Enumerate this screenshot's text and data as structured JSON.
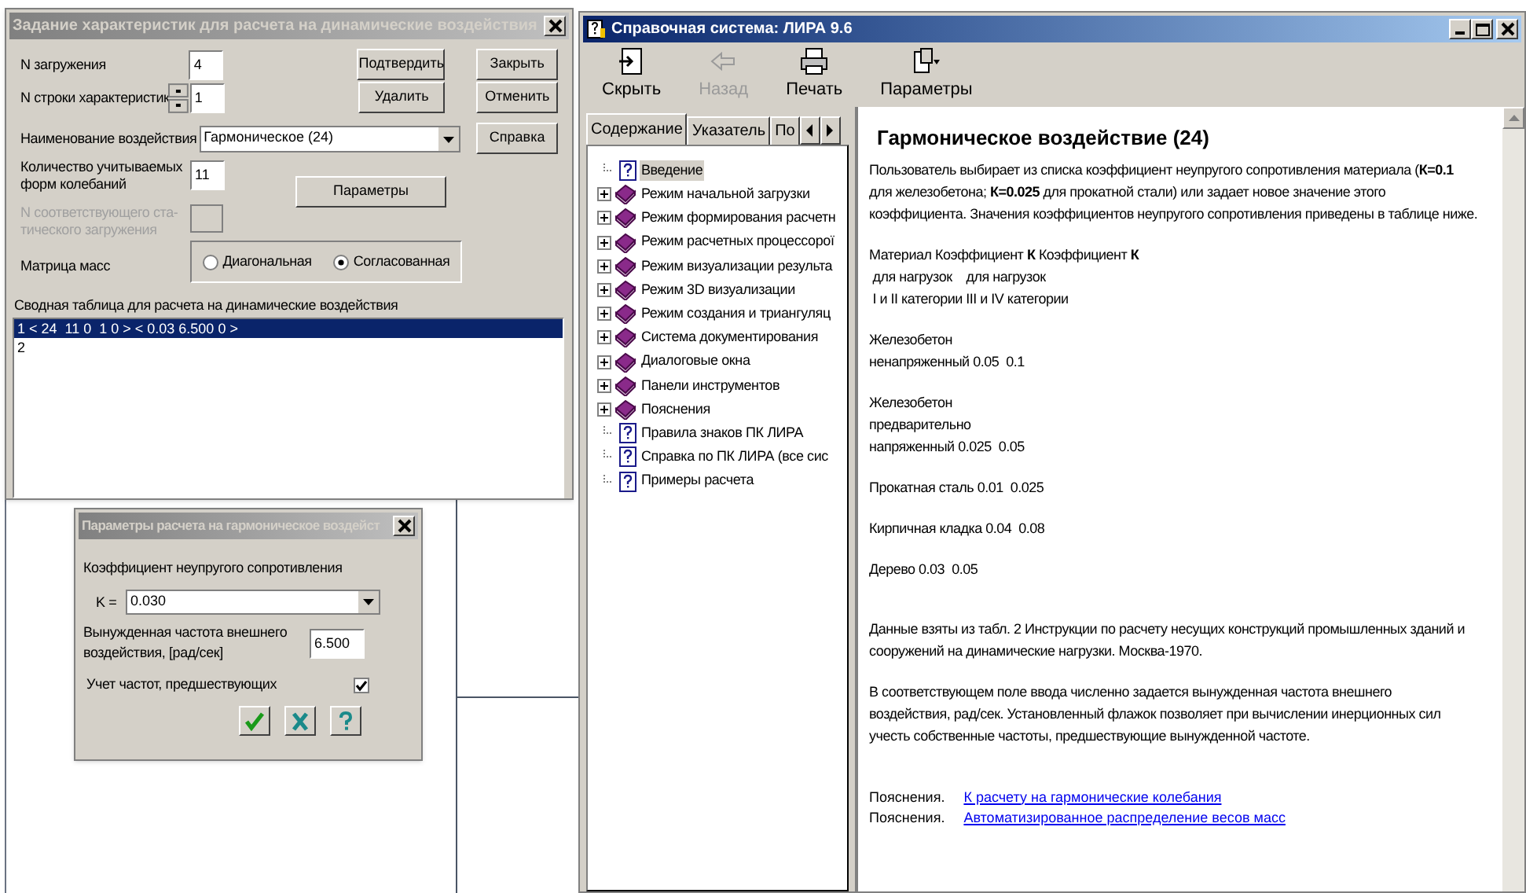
{
  "main_dialog": {
    "title": "Задание характеристик для расчета на динамические воздействия",
    "load_number": {
      "label": "N загружения",
      "value": "4"
    },
    "row_number": {
      "label": "N строки характеристик",
      "value": "1"
    },
    "action_name": {
      "label": "Наименование воздействия",
      "value": "Гармоническое  (24)"
    },
    "mode_count": {
      "label": [
        "Количество учитываемых",
        "форм колебаний"
      ],
      "value": "11"
    },
    "static_load": {
      "label": [
        "N соответствующего ста-",
        "тического загружения"
      ],
      "disabled": true
    },
    "params_button": "Параметры",
    "mass_matrix": {
      "label": "Матрица масс",
      "options": [
        {
          "label": "Диагональная",
          "selected": false
        },
        {
          "label": "Согласованная",
          "selected": true
        }
      ]
    },
    "action_buttons": [
      "Подтвердить",
      "Удалить"
    ],
    "side_buttons": [
      "Закрыть",
      "Отменить",
      "Справка"
    ],
    "table": {
      "caption": "Сводная таблица для расчета на динамические воздействия",
      "rows": [
        {
          "text": "1 < 24  11 0  1 0 > < 0.03 6.500 0 >",
          "selected": true
        },
        {
          "text": "2",
          "selected": false
        }
      ]
    }
  },
  "params_dialog": {
    "title": "Параметры расчета на гармоническое воздейст",
    "coef_label": "Коэффициент неупругого сопротивления",
    "k_label": "K =",
    "k_value": "0.030",
    "freq_label": [
      "Вынужденная частота внешнего",
      "воздействия,  [рад/сек]"
    ],
    "freq_value": "6.500",
    "preceding": {
      "label": "Учет частот, предшествующих",
      "checked": true
    },
    "buttons": [
      {
        "kind": "ok"
      },
      {
        "kind": "cancel"
      },
      {
        "kind": "help"
      }
    ]
  },
  "help_window": {
    "title": "Справочная система: ЛИРА 9.6",
    "toolbar": [
      {
        "kind": "hide",
        "label": "Скрыть",
        "disabled": false
      },
      {
        "kind": "back",
        "label": "Назад",
        "disabled": true
      },
      {
        "kind": "print",
        "label": "Печать",
        "disabled": false
      },
      {
        "kind": "options",
        "label": "Параметры",
        "disabled": false
      }
    ],
    "tabs": [
      {
        "label": "Содержание",
        "selected": true
      },
      {
        "label": "Указатель",
        "selected": false
      },
      {
        "label": "По",
        "selected": false
      }
    ],
    "tree": [
      {
        "kind": "page",
        "label": "Введение",
        "selected": true
      },
      {
        "kind": "book",
        "label": "Режим начальной загрузки",
        "selected": false
      },
      {
        "kind": "book",
        "label": "Режим формирования расчетн",
        "selected": false
      },
      {
        "kind": "book",
        "label": "Режим расчетных процессорої",
        "selected": false
      },
      {
        "kind": "book",
        "label": "Режим визуализации результа",
        "selected": false
      },
      {
        "kind": "book",
        "label": "Режим 3D визуализации",
        "selected": false
      },
      {
        "kind": "book",
        "label": "Режим создания и триангуляц",
        "selected": false
      },
      {
        "kind": "book",
        "label": "Система документирования",
        "selected": false
      },
      {
        "kind": "book",
        "label": "Диалоговые окна",
        "selected": false
      },
      {
        "kind": "book",
        "label": "Панели инструментов",
        "selected": false
      },
      {
        "kind": "book",
        "label": "Пояснения",
        "selected": false
      },
      {
        "kind": "page",
        "label": "Правила знаков ПК ЛИРА",
        "selected": false
      },
      {
        "kind": "page",
        "label": "Справка по ПК ЛИРА (все сис",
        "selected": false
      },
      {
        "kind": "page",
        "label": "Примеры расчета",
        "selected": false
      }
    ],
    "content": {
      "title": "Гармоническое воздействие (24)",
      "paragraphs": [
        [
          "Пользователь выбирает из списка коэффициент неупругого сопротивления материала (**К=0.1**",
          "для железобетона; **К=0.025** для прокатной стали) или задает новое значение этого",
          "коэффициента. Значения коэффициентов неупругого сопротивления приведены в таблице ниже."
        ],
        [
          "Материал Коэффициент **К** Коэффициент **К**",
          " для нагрузок    для нагрузок",
          " I и II категории III и IV категории"
        ],
        [
          "Железобетон",
          "ненапряженный 0.05  0.1"
        ],
        [
          "Железобетон",
          "предварительно",
          "напряженный 0.025  0.05"
        ],
        [
          "Прокатная сталь 0.01  0.025"
        ],
        [
          "Кирпичная кладка 0.04  0.08"
        ],
        [
          "Дерево 0.03  0.05"
        ],
        [
          "Данные взяты из табл. 2 Инструкции по расчету несущих конструкций промышленных зданий и",
          "сооружений на динамические нагрузки. Москва-1970."
        ],
        [
          "В соответствующем поле ввода численно задается вынужденная частота внешнего",
          "воздействия, рад/сек. Установленный флажок позволяет при вычислении инерционных сил",
          "учесть собственные частоты, предшествующие вынужденной частоте."
        ]
      ],
      "links": [
        {
          "prefix": "Пояснения.",
          "link": "К расчету на гармонические колебания"
        },
        {
          "prefix": "Пояснения.",
          "link": "Автоматизированное распределение весов масс"
        }
      ]
    }
  }
}
